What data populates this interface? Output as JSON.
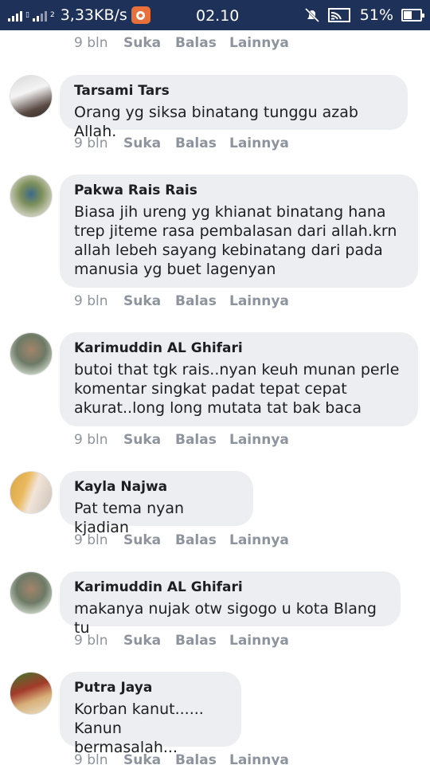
{
  "status_bar": {
    "network_label": "2",
    "data_speed": "3,33KB/s",
    "time": "02.10",
    "battery_percent": "51%",
    "battery_level": 0.51,
    "icons": [
      "signal-icon",
      "sim-icon",
      "recorder-icon",
      "mute-icon",
      "wifi-icon",
      "battery-icon"
    ]
  },
  "top_meta": {
    "age": "9 bln",
    "like": "Suka",
    "reply": "Balas",
    "more": "Lainnya"
  },
  "comments": [
    {
      "author": "Tarsami Tars",
      "text": "Orang yg siksa binatang tunggu azab Allah.",
      "age": "9 bln",
      "like": "Suka",
      "reply": "Balas",
      "more": "Lainnya"
    },
    {
      "author": "Pakwa Rais Rais",
      "text": "Biasa jih ureng yg khianat binatang hana\ntrep jiteme rasa pembalasan dari allah.krn\nallah lebeh sayang kebinatang dari pada\nmanusia yg buet lagenyan",
      "age": "9 bln",
      "like": "Suka",
      "reply": "Balas",
      "more": "Lainnya"
    },
    {
      "author": "Karimuddin AL Ghifari",
      "text": "butoi that tgk rais..nyan keuh munan perle\nkomentar singkat padat tepat cepat\nakurat..long long mutata tat bak baca",
      "age": "9 bln",
      "like": "Suka",
      "reply": "Balas",
      "more": "Lainnya"
    },
    {
      "author": "Kayla Najwa",
      "text": "Pat tema nyan kjadian",
      "age": "9 bln",
      "like": "Suka",
      "reply": "Balas",
      "more": "Lainnya"
    },
    {
      "author": "Karimuddin AL Ghifari",
      "text": "makanya nujak otw sigogo u kota Blang tu",
      "age": "9 bln",
      "like": "Suka",
      "reply": "Balas",
      "more": "Lainnya"
    },
    {
      "author": "Putra Jaya",
      "text": "Korban kanut......\nKanun bermasalah...",
      "age": "9 bln",
      "like": "Suka",
      "reply": "Balas",
      "more": "Lainnya"
    }
  ]
}
